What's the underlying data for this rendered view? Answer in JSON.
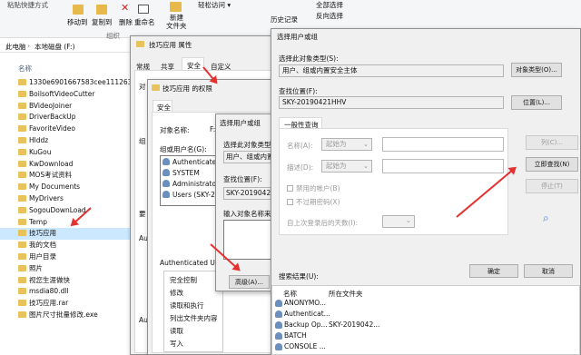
{
  "ribbon": {
    "paste_shortcut": "粘贴快捷方式",
    "move_to": "移动到",
    "copy_to": "复制到",
    "delete": "删除",
    "rename": "重命名",
    "new_folder_line1": "新建",
    "new_folder_line2": "文件夹",
    "easy_access": "轻松访问 ▾",
    "history": "历史记录",
    "select_all": "全部选择",
    "invert_select": "反向选择",
    "group_organize": "组织"
  },
  "address": {
    "crumbs": [
      "此电脑",
      "本地磁盘 (F:)"
    ]
  },
  "file_list": {
    "column_name": "名称",
    "items": [
      "1330e6901667583cee111263",
      "BoilsoftVideoCutter",
      "BVideoJoiner",
      "DriverBackUp",
      "FavoriteVideo",
      "Hlddz",
      "KuGou",
      "KwDownload",
      "MOS考试资料",
      "My Documents",
      "MyDrivers",
      "SogouDownLoad",
      "Temp",
      "技巧应用",
      "我的文档",
      "用户目录",
      "照片",
      "视您生涯做快",
      "msdia80.dll",
      "技巧应用.rar",
      "图片尺寸批量修改.exe"
    ],
    "selected_index": 13
  },
  "props": {
    "title": "技巧应用 属性",
    "tabs": [
      "常规",
      "共享",
      "安全",
      "自定义"
    ],
    "active_tab": 2,
    "side_labels": [
      "对",
      "组",
      "要",
      "Au",
      "Au"
    ]
  },
  "advsec": {
    "title": "技巧应用 的权限",
    "tab": "安全",
    "object_label": "对象名称:",
    "object_value": "F:\\",
    "group_label": "组或用户名(G):",
    "users": [
      "Authenticated",
      "SYSTEM",
      "Administrators",
      "Users (SKY-20"
    ],
    "perm_label": "Authenticated Users",
    "perms": [
      "完全控制",
      "修改",
      "读取和执行",
      "列出文件夹内容",
      "读取",
      "写入"
    ]
  },
  "small": {
    "title": "选择用户或组",
    "obj_type_label": "选择此对象类型(S):",
    "obj_type_value": "用户、组或内置",
    "location_label": "查找位置(F):",
    "location_value": "SKY-20190421",
    "names_label": "输入对象名称来选",
    "advanced": "高级(A)..."
  },
  "main": {
    "title": "选择用户或组",
    "obj_type_label": "选择此对象类型(S):",
    "obj_type_value": "用户、组或内置安全主体",
    "obj_type_btn": "对象类型(O)...",
    "location_label": "查找位置(F):",
    "location_value": "SKY-20190421HHV",
    "location_btn": "位置(L)...",
    "tab": "一般性查询",
    "name_label": "名称(A):",
    "name_mode": "起始为",
    "desc_label": "描述(D):",
    "desc_mode": "起始为",
    "col_btn": "列(C)...",
    "find_btn": "立即查找(N)",
    "stop_btn": "停止(T)",
    "disabled_acct": "禁用的帐户(B)",
    "no_expire": "不过期密码(X)",
    "days_label": "自上次登录后的天数(I):",
    "results_label": "搜索结果(U):",
    "ok_btn": "确定",
    "cancel_btn": "取消",
    "col_name": "名称",
    "col_folder": "所在文件夹",
    "results": [
      {
        "name": "ANONYMO...",
        "folder": ""
      },
      {
        "name": "Authenticat...",
        "folder": ""
      },
      {
        "name": "Backup Op...",
        "folder": "SKY-2019042..."
      },
      {
        "name": "BATCH",
        "folder": ""
      },
      {
        "name": "CONSOLE ...",
        "folder": ""
      }
    ]
  }
}
